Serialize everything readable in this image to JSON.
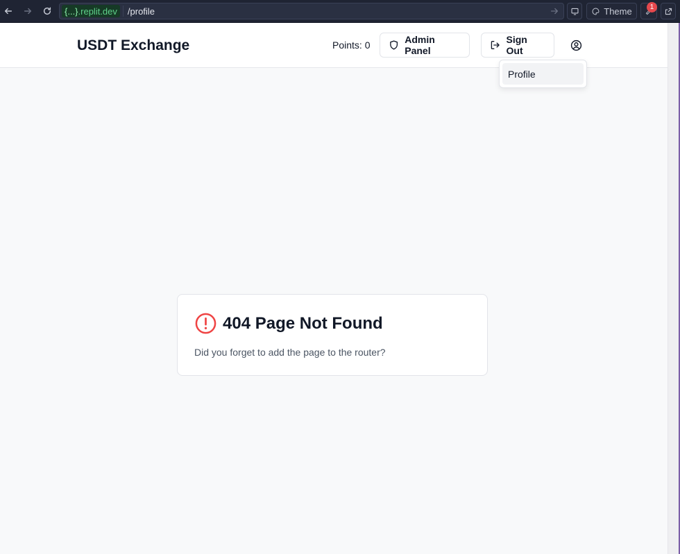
{
  "browser": {
    "domain": ".replit.dev",
    "domain_prefix": "{...}",
    "path": "/profile",
    "theme_label": "Theme",
    "notification_count": "1"
  },
  "header": {
    "brand": "USDT Exchange",
    "points": "Points: 0",
    "admin_label": "Admin Panel",
    "signout_label": "Sign Out"
  },
  "dropdown": {
    "items": [
      {
        "label": "Profile"
      }
    ]
  },
  "error_card": {
    "title": "404 Page Not Found",
    "message": "Did you forget to add the page to the router?"
  },
  "colors": {
    "error_red": "#ef4444",
    "browser_bar": "#1f2433",
    "domain_green": "#5fd08a",
    "page_bg": "#f8f9fa"
  }
}
